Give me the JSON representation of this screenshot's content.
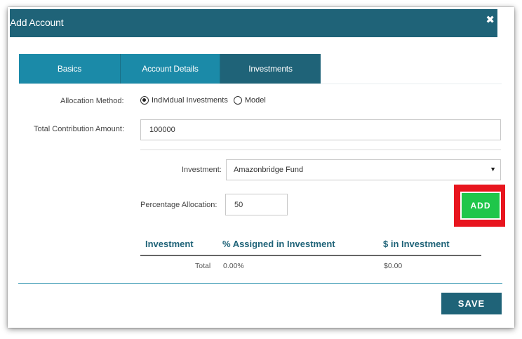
{
  "dialog": {
    "title": "Add Account",
    "close_icon": "close-icon"
  },
  "tabs": [
    {
      "label": "Basics"
    },
    {
      "label": "Account Details"
    },
    {
      "label": "Investments"
    }
  ],
  "form": {
    "allocation_method_label": "Allocation Method:",
    "allocation_options": [
      {
        "label": "Individual Investments",
        "checked": true
      },
      {
        "label": "Model",
        "checked": false
      }
    ],
    "total_contribution_label": "Total Contribution Amount:",
    "total_contribution_value": "100000",
    "investment_label": "Investment:",
    "investment_value": "Amazonbridge Fund",
    "percentage_label": "Percentage Allocation:",
    "percentage_value": "50",
    "add_label": "ADD"
  },
  "table": {
    "headers": [
      "Investment",
      "% Assigned in Investment",
      "$ in Investment"
    ],
    "total_row": {
      "label": "Total",
      "percent": "0.00%",
      "amount": "$0.00"
    }
  },
  "footer": {
    "save_label": "SAVE"
  },
  "colors": {
    "header": "#1f6378",
    "tab": "#1b8aa8",
    "add_button": "#1fc64a",
    "highlight": "#e8151e"
  }
}
